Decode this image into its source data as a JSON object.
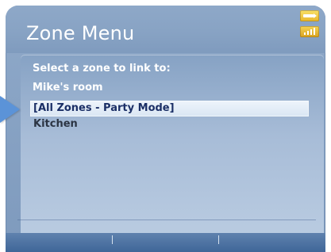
{
  "header": {
    "title": "Zone Menu"
  },
  "status": {
    "battery_icon": "battery-icon",
    "signal_icon": "signal-strength-icon"
  },
  "panel": {
    "prompt": "Select a zone to link to:",
    "source_zone": "Mike's room",
    "items": [
      {
        "label": "[All Zones - Party Mode]",
        "selected": true
      },
      {
        "label": "Kitchen",
        "selected": false
      }
    ]
  },
  "colors": {
    "screen_bg": "#8fa9c9",
    "selection_bg": "#e3edf8",
    "pointer_arrow": "#5b93d8",
    "softkey_bar": "#4a6fa2",
    "status_icon": "#f0c63f"
  }
}
